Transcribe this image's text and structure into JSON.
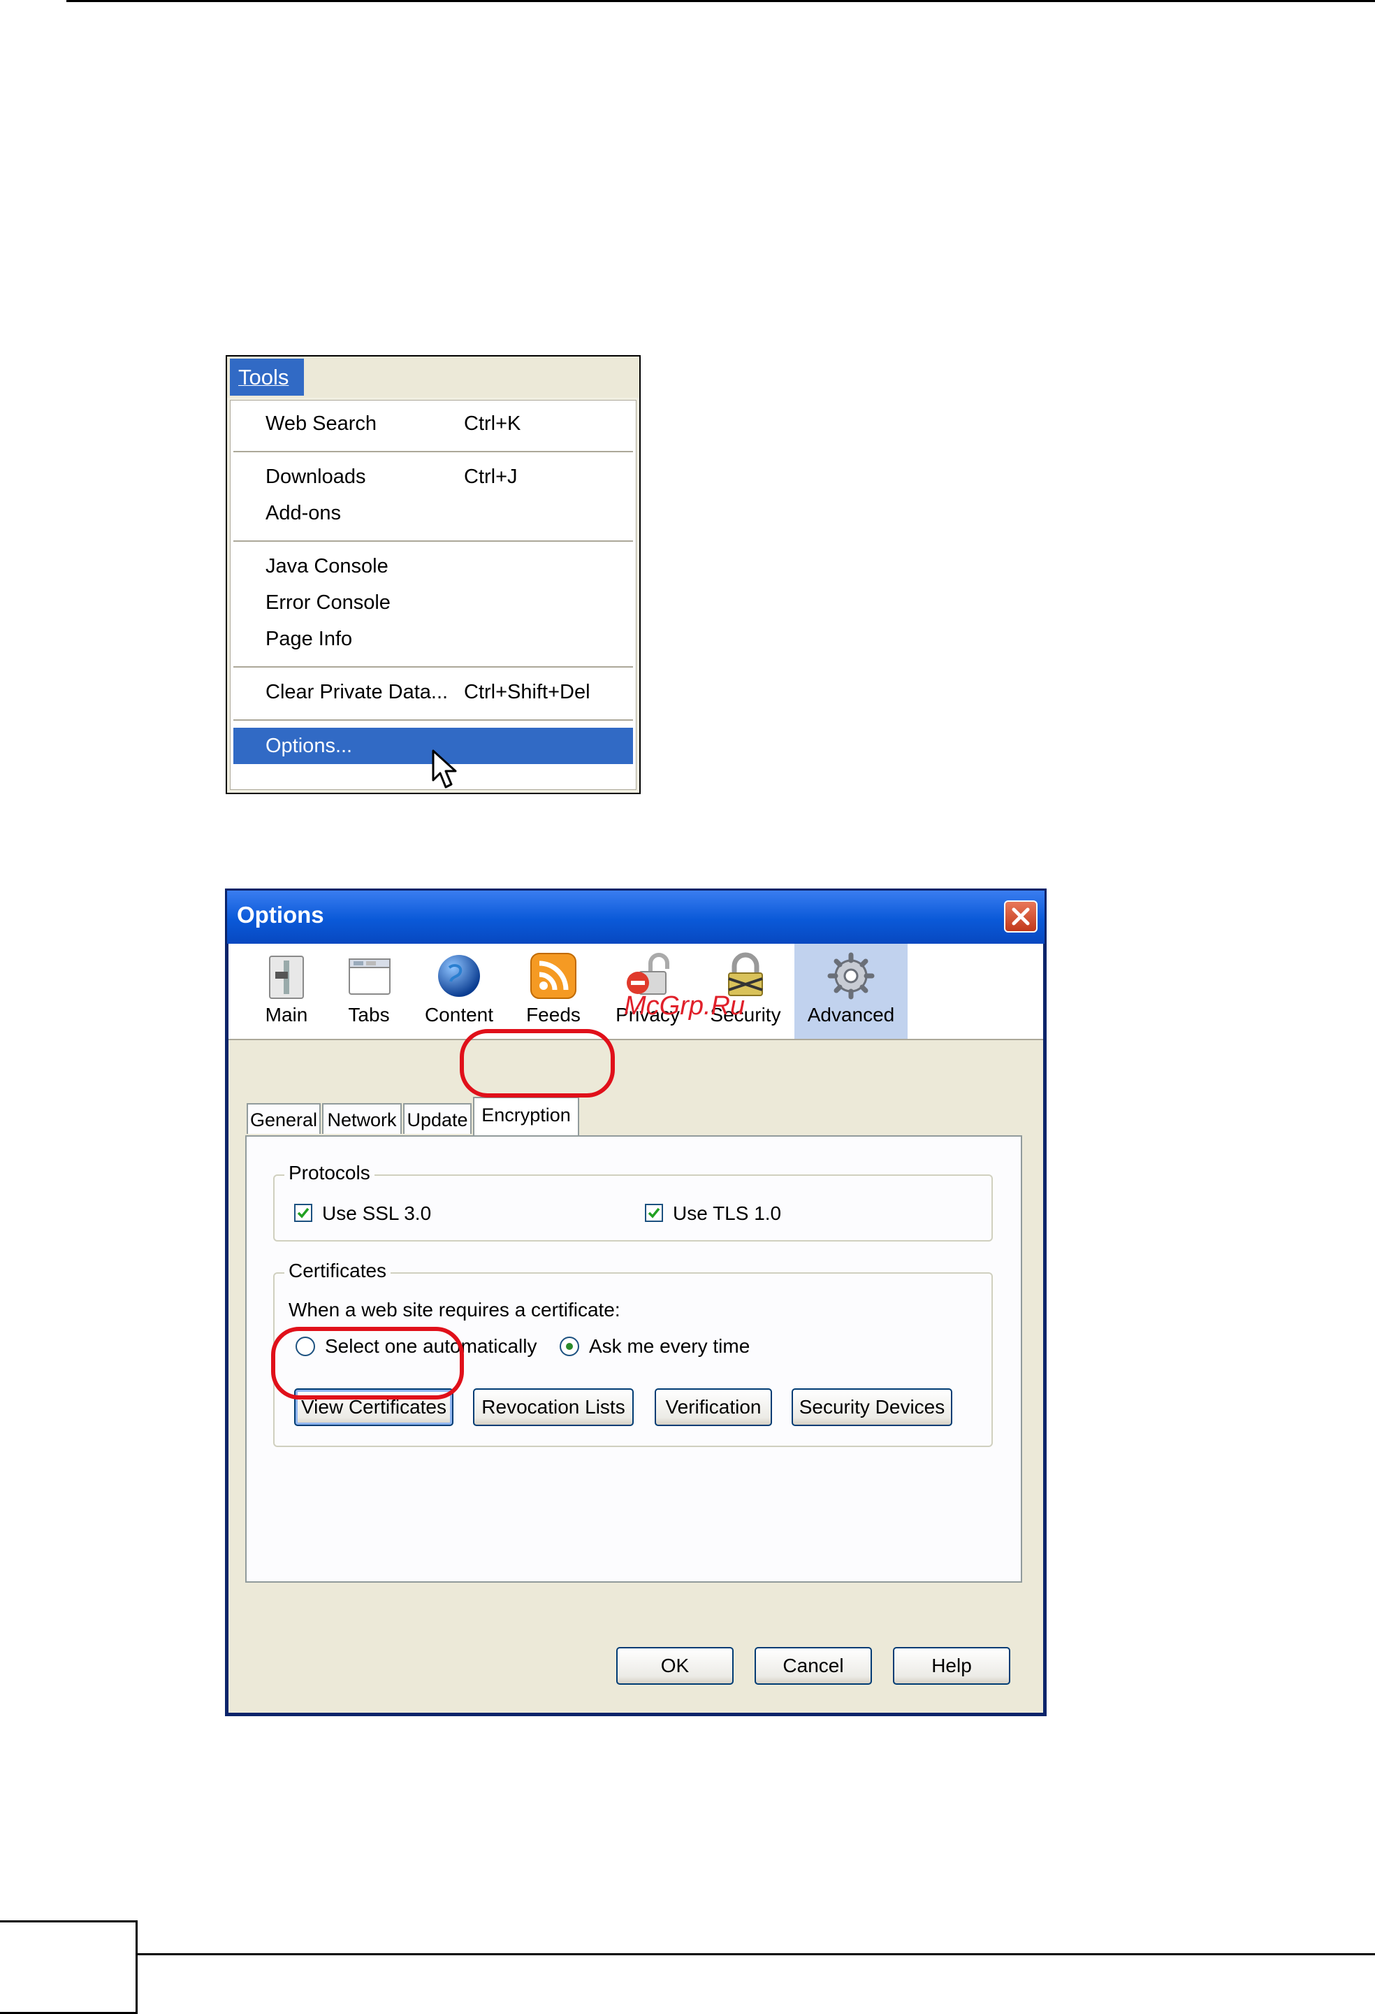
{
  "tools_menu": {
    "title": "Tools",
    "items": [
      {
        "label": "Web Search",
        "shortcut": "Ctrl+K"
      },
      {
        "label": "Downloads",
        "shortcut": "Ctrl+J"
      },
      {
        "label": "Add-ons",
        "shortcut": ""
      },
      {
        "label": "Java Console",
        "shortcut": ""
      },
      {
        "label": "Error Console",
        "shortcut": ""
      },
      {
        "label": "Page Info",
        "shortcut": ""
      },
      {
        "label": "Clear Private Data...",
        "shortcut": "Ctrl+Shift+Del"
      },
      {
        "label": "Options...",
        "shortcut": ""
      }
    ],
    "selected_item": "Options..."
  },
  "options_dialog": {
    "title": "Options",
    "panes": [
      {
        "label": "Main",
        "icon": "main-switch-icon"
      },
      {
        "label": "Tabs",
        "icon": "tabs-window-icon"
      },
      {
        "label": "Content",
        "icon": "globe-icon"
      },
      {
        "label": "Feeds",
        "icon": "rss-feed-icon"
      },
      {
        "label": "Privacy",
        "icon": "privacy-lock-icon"
      },
      {
        "label": "Security",
        "icon": "security-padlock-icon"
      },
      {
        "label": "Advanced",
        "icon": "gear-icon"
      }
    ],
    "active_pane": "Advanced",
    "tabs": [
      "General",
      "Network",
      "Update",
      "Encryption"
    ],
    "active_tab": "Encryption",
    "protocols": {
      "title": "Protocols",
      "ssl_label": "Use SSL 3.0",
      "ssl_checked": true,
      "tls_label": "Use TLS 1.0",
      "tls_checked": true
    },
    "certificates": {
      "title": "Certificates",
      "prompt": "When a web site requires a certificate:",
      "radio_auto": "Select one automatically",
      "radio_ask": "Ask me every time",
      "selected_radio": "Ask me every time",
      "buttons": [
        "View Certificates",
        "Revocation Lists",
        "Verification",
        "Security Devices"
      ]
    },
    "footer_buttons": [
      "OK",
      "Cancel",
      "Help"
    ]
  },
  "watermark": "McGrp.Ru",
  "colors": {
    "highlight": "#e0101a",
    "menu_selection": "#316ac5",
    "titlebar": "#0a59d8"
  }
}
